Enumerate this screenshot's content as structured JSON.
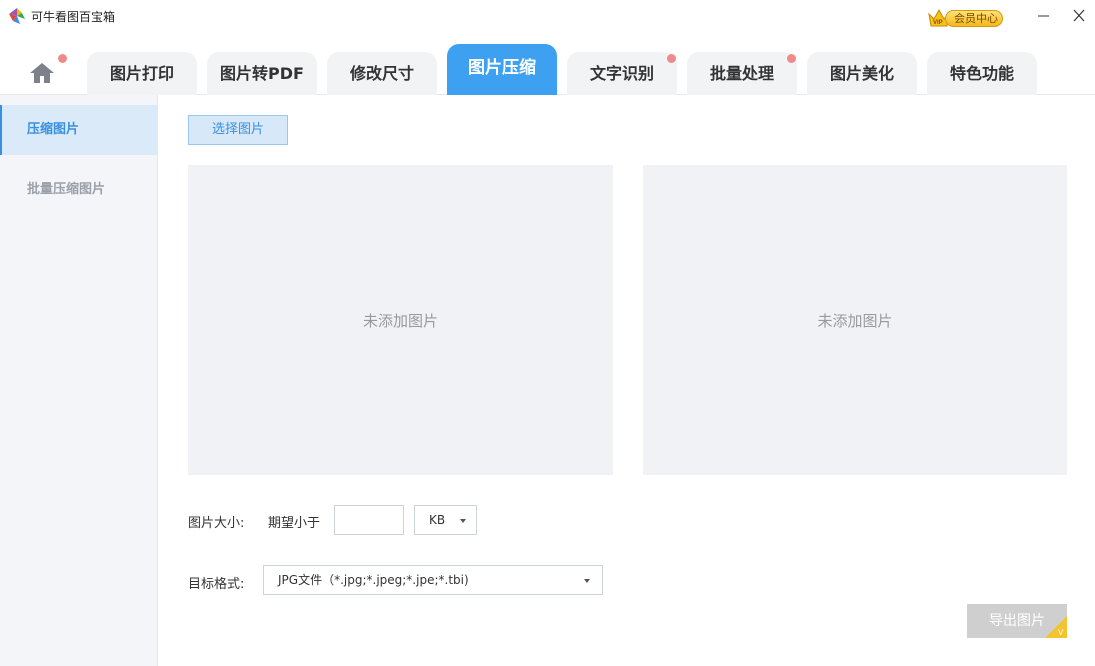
{
  "app": {
    "title": "可牛看图百宝箱"
  },
  "vip": {
    "label": "会员中心"
  },
  "tabs": [
    {
      "label": "图片打印"
    },
    {
      "label": "图片转PDF"
    },
    {
      "label": "修改尺寸"
    },
    {
      "label": "图片压缩"
    },
    {
      "label": "文字识别"
    },
    {
      "label": "批量处理"
    },
    {
      "label": "图片美化"
    },
    {
      "label": "特色功能"
    }
  ],
  "sidebar": {
    "items": [
      {
        "label": "压缩图片"
      },
      {
        "label": "批量压缩图片"
      }
    ]
  },
  "main": {
    "select_button": "选择图片",
    "preview_left_placeholder": "未添加图片",
    "preview_right_placeholder": "未添加图片",
    "size_label": "图片大小:",
    "expect_label": "期望小于",
    "size_value": "",
    "unit_value": "KB",
    "format_label": "目标格式:",
    "format_value": "JPG文件（*.jpg;*.jpeg;*.jpe;*.tbi)",
    "export_button": "导出图片"
  },
  "colors": {
    "accent": "#3ea0f0",
    "notification_dot": "#f08a8a"
  }
}
